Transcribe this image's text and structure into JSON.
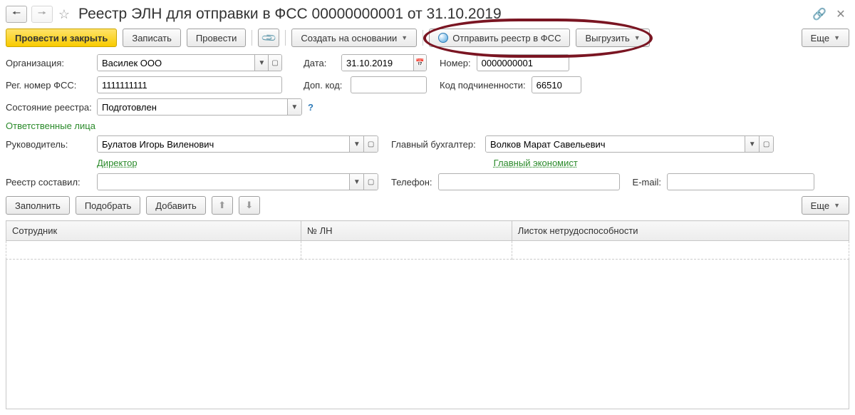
{
  "header": {
    "title": "Реестр ЭЛН для отправки в ФСС 00000000001 от 31.10.2019"
  },
  "toolbar": {
    "post_close": "Провести и закрыть",
    "save": "Записать",
    "post": "Провести",
    "create_based": "Создать на основании",
    "send_registry": "Отправить реестр в ФСС",
    "export": "Выгрузить",
    "more": "Еще"
  },
  "fields": {
    "org_label": "Организация:",
    "org_value": "Василек ООО",
    "date_label": "Дата:",
    "date_value": "31.10.2019",
    "number_label": "Номер:",
    "number_value": "0000000001",
    "reg_fss_label": "Рег. номер ФСС:",
    "reg_fss_value": "1111111111",
    "dop_code_label": "Доп. код:",
    "dop_code_value": "",
    "sub_code_label": "Код подчиненности:",
    "sub_code_value": "66510",
    "state_label": "Состояние реестра:",
    "state_value": "Подготовлен"
  },
  "responsible": {
    "section_title": "Ответственные лица",
    "head_label": "Руководитель:",
    "head_value": "Булатов Игорь Виленович",
    "head_link": "Директор",
    "accountant_label": "Главный бухгалтер:",
    "accountant_value": "Волков Марат Савельевич",
    "accountant_link": "Главный экономист",
    "compiled_label": "Реестр составил:",
    "compiled_value": "",
    "phone_label": "Телефон:",
    "phone_value": "",
    "email_label": "E-mail:",
    "email_value": ""
  },
  "sub_toolbar": {
    "fill": "Заполнить",
    "select": "Подобрать",
    "add": "Добавить",
    "more": "Еще"
  },
  "table": {
    "col_employee": "Сотрудник",
    "col_ln": "№ ЛН",
    "col_sheet": "Листок нетрудоспособности"
  }
}
